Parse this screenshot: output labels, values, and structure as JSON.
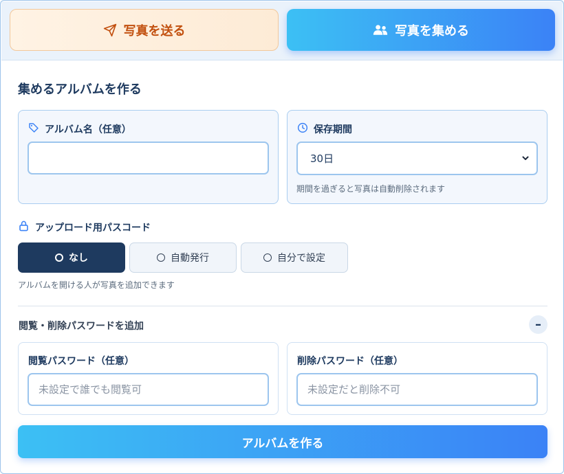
{
  "mode_tabs": {
    "send": {
      "label": "写真を送る",
      "icon": "send-icon",
      "color": "#c2500f"
    },
    "collect": {
      "label": "写真を集める",
      "icon": "users-icon",
      "color": "#ffffff"
    }
  },
  "section_title": "集めるアルバムを作る",
  "album_name": {
    "label": "アルバム名（任意）",
    "icon": "tag-icon",
    "value": "",
    "placeholder": ""
  },
  "retention": {
    "label": "保存期間",
    "icon": "clock-icon",
    "selected": "30日",
    "hint": "期間を過ぎると写真は自動削除されます"
  },
  "passcode": {
    "label": "アップロード用パスコード",
    "icon": "lock-icon",
    "options": [
      {
        "label": "なし",
        "selected": true
      },
      {
        "label": "自動発行",
        "selected": false
      },
      {
        "label": "自分で設定",
        "selected": false
      }
    ],
    "hint": "アルバムを開ける人が写真を追加できます"
  },
  "extra": {
    "label": "閲覧・削除パスワードを追加",
    "toggle": "–",
    "view_password": {
      "label": "閲覧パスワード（任意）",
      "placeholder": "未設定で誰でも閲覧可"
    },
    "delete_password": {
      "label": "削除パスワード（任意）",
      "placeholder": "未設定だと削除不可"
    }
  },
  "submit_label": "アルバムを作る",
  "colors": {
    "accent": "#3b82f6",
    "accent_light": "#3cc0f4",
    "navy": "#1e3a5f",
    "orange": "#c2500f"
  }
}
